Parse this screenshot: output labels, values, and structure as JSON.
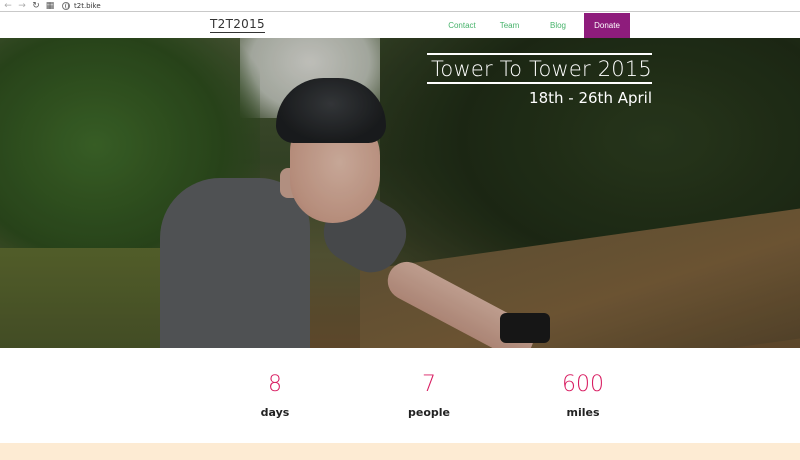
{
  "browser": {
    "back_icon": "arrow-left-icon",
    "forward_icon": "arrow-right-icon",
    "reload_icon": "reload-icon",
    "apps_icon": "apps-grid-icon",
    "url": "t2t.bike"
  },
  "header": {
    "logo": "T2T2015",
    "nav": [
      {
        "label": "Contact"
      },
      {
        "label": "Team"
      },
      {
        "label": "Blog"
      },
      {
        "label": "Donate"
      }
    ],
    "link_color": "#47b36b",
    "donate_color": "#8e1c7c"
  },
  "hero": {
    "title": "Tower To Tower 2015",
    "dates": "18th - 26th April"
  },
  "stats": [
    {
      "value": "8",
      "label": "days"
    },
    {
      "value": "7",
      "label": "people"
    },
    {
      "value": "600",
      "label": "miles"
    }
  ],
  "accent_color": "#d81b60"
}
